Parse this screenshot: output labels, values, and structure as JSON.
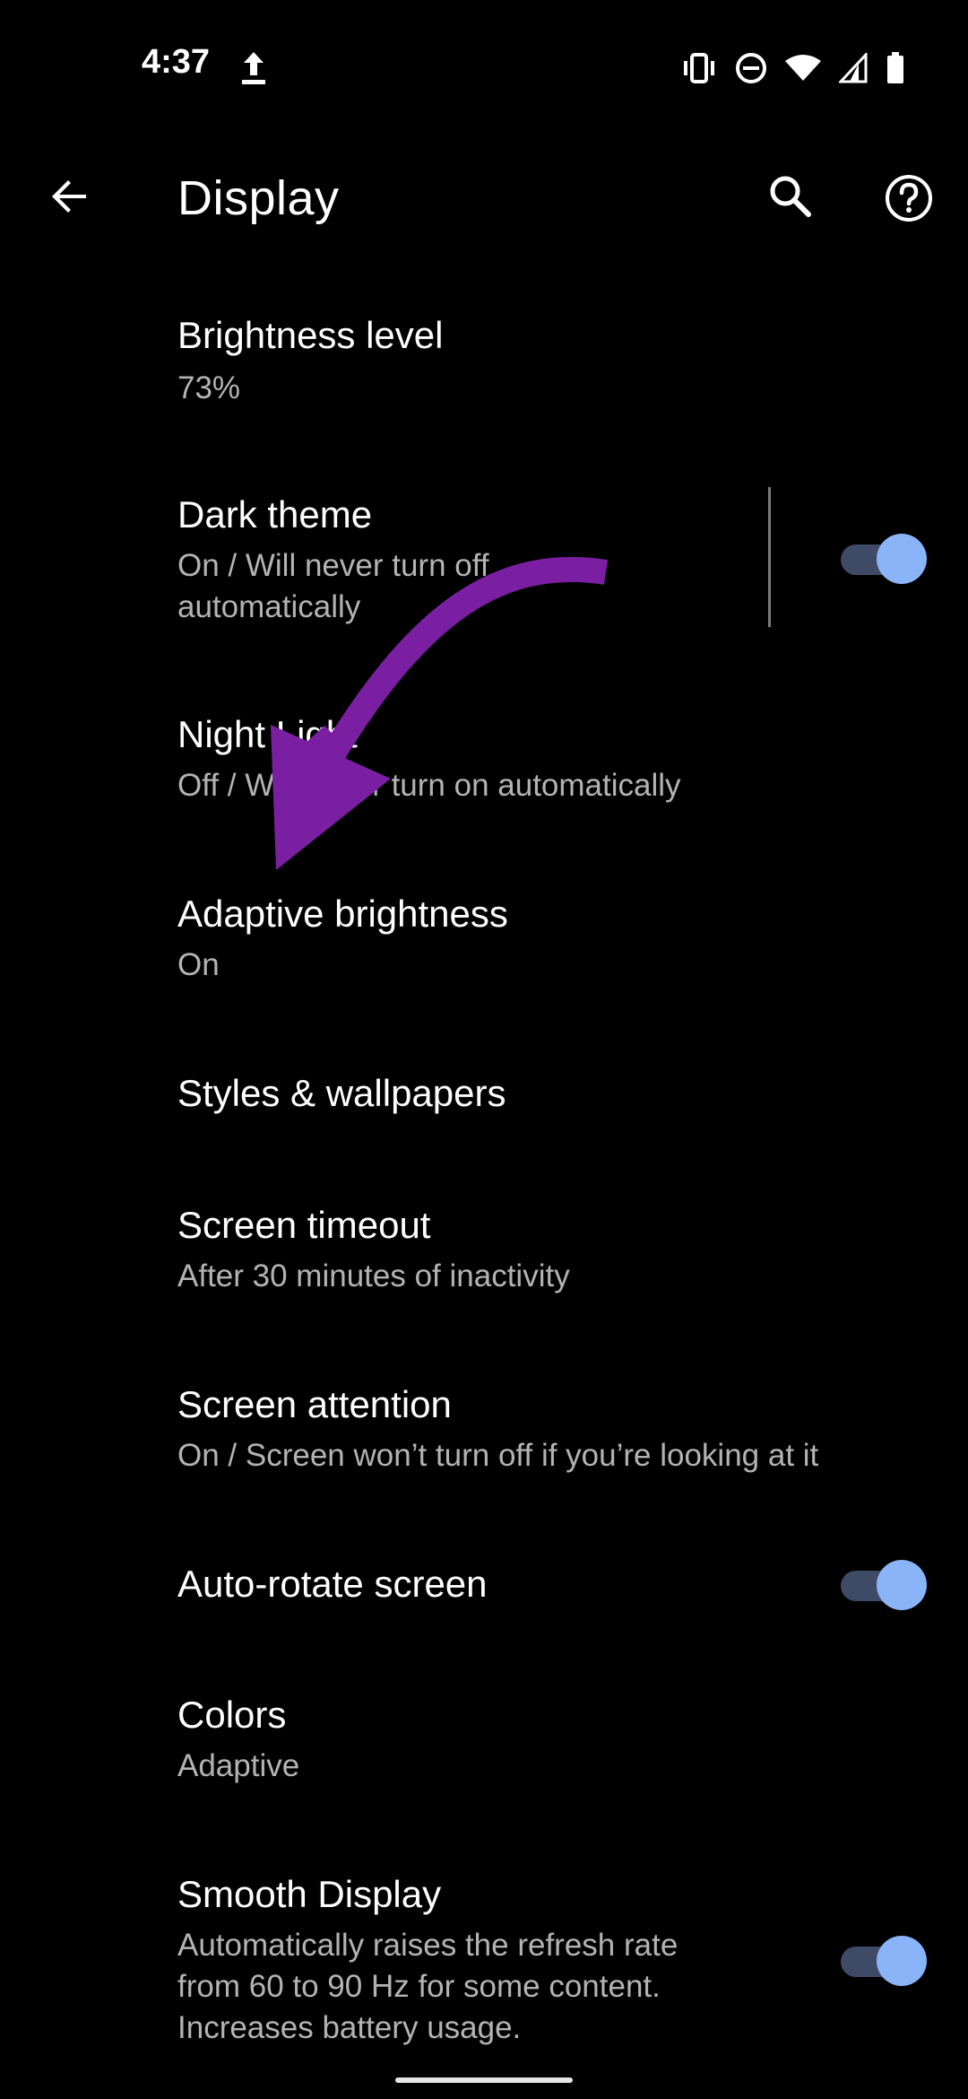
{
  "status_bar": {
    "time": "4:37",
    "icons": [
      "upload-icon",
      "vibrate-icon",
      "do-not-disturb-icon",
      "wifi-icon",
      "signal-icon",
      "battery-icon"
    ]
  },
  "app_bar": {
    "title": "Display",
    "icons": [
      "back-arrow-icon",
      "search-icon",
      "help-icon"
    ]
  },
  "settings": {
    "brightness_level": {
      "title": "Brightness level",
      "summary": "73%"
    },
    "dark_theme": {
      "title": "Dark theme",
      "summary_line1": "On / Will never turn off",
      "summary_line2": "automatically",
      "toggle_on": true
    },
    "night_light": {
      "title": "Night Light",
      "summary": "Off / Will never turn on automatically"
    },
    "adaptive_brightness": {
      "title": "Adaptive brightness",
      "summary": "On"
    },
    "styles_wallpapers": {
      "title": "Styles & wallpapers"
    },
    "screen_timeout": {
      "title": "Screen timeout",
      "summary": "After 30 minutes of inactivity"
    },
    "screen_attention": {
      "title": "Screen attention",
      "summary": "On / Screen won’t turn off if you’re looking at it"
    },
    "auto_rotate": {
      "title": "Auto-rotate screen",
      "toggle_on": true
    },
    "colors": {
      "title": "Colors",
      "summary": "Adaptive"
    },
    "smooth_display": {
      "title": "Smooth Display",
      "summary_line1": "Automatically raises the refresh rate",
      "summary_line2": "from 60 to 90 Hz for some content.",
      "summary_line3": "Increases battery usage.",
      "toggle_on": true
    }
  },
  "colors": {
    "background": "#000000",
    "toggle_thumb": "#8ab4f8",
    "toggle_track": "#3f4a66",
    "annotation_arrow": "#7b1fa2"
  }
}
